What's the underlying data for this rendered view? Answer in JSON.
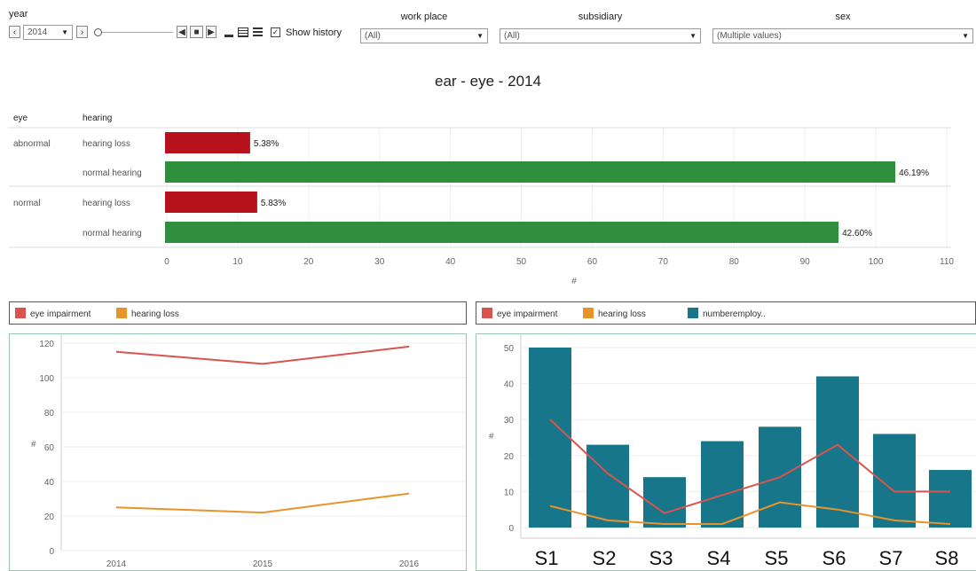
{
  "filters": {
    "year_label": "year",
    "year_value": "2014",
    "show_history_label": "Show history",
    "workplace_label": "work place",
    "workplace_value": "(All)",
    "subsidiary_label": "subsidiary",
    "subsidiary_value": "(All)",
    "sex_label": "sex",
    "sex_value": "(Multiple values)"
  },
  "icons": {
    "prev": "‹",
    "next": "›",
    "dropdown_arrow": "▼",
    "play_back": "◀",
    "stop": "■",
    "play": "▶",
    "check": "✓"
  },
  "colors": {
    "hearing_loss_bar": "#b5121b",
    "normal_hearing_bar": "#2f8f3c",
    "eye_impairment": "#d9544f",
    "hearing_loss_line": "#e8942a",
    "numberemployees": "#17768a"
  },
  "chart_data": [
    {
      "type": "bar",
      "orientation": "horizontal",
      "title": "ear - eye - 2014",
      "row_headers": [
        "eye",
        "hearing"
      ],
      "rows": [
        {
          "eye": "abnormal",
          "hearing": "hearing loss",
          "value": 12,
          "label": "5.38%"
        },
        {
          "eye": "",
          "hearing": "normal hearing",
          "value": 103,
          "label": "46.19%"
        },
        {
          "eye": "normal",
          "hearing": "hearing loss",
          "value": 13,
          "label": "5.83%"
        },
        {
          "eye": "",
          "hearing": "normal hearing",
          "value": 95,
          "label": "42.60%"
        }
      ],
      "xlim": [
        0,
        110
      ],
      "xticks": [
        0,
        10,
        20,
        30,
        40,
        50,
        60,
        70,
        80,
        90,
        100,
        110
      ],
      "xlabel": "#"
    },
    {
      "type": "line",
      "legend": [
        "eye impairment",
        "hearing loss"
      ],
      "x": [
        "2014",
        "2015",
        "2016"
      ],
      "series": [
        {
          "name": "eye impairment",
          "values": [
            115,
            108,
            118
          ]
        },
        {
          "name": "hearing loss",
          "values": [
            25,
            22,
            33
          ]
        }
      ],
      "ylim": [
        0,
        120
      ],
      "yticks": [
        0,
        20,
        40,
        60,
        80,
        100,
        120
      ],
      "ylabel": "#"
    },
    {
      "type": "bar",
      "legend": [
        "eye impairment",
        "hearing loss",
        "numberemploy.."
      ],
      "categories": [
        "S1",
        "S2",
        "S3",
        "S4",
        "S5",
        "S6",
        "S7",
        "S8"
      ],
      "series": [
        {
          "name": "numberemploy..",
          "kind": "bar",
          "values": [
            50,
            23,
            14,
            24,
            28,
            42,
            26,
            16
          ]
        },
        {
          "name": "eye impairment",
          "kind": "line",
          "values": [
            30,
            15,
            4,
            9,
            14,
            23,
            10,
            10
          ]
        },
        {
          "name": "hearing loss",
          "kind": "line",
          "values": [
            6,
            2,
            1,
            1,
            7,
            5,
            2,
            1
          ]
        }
      ],
      "ylim": [
        0,
        50
      ],
      "yticks": [
        0,
        10,
        20,
        30,
        40,
        50
      ],
      "ylabel": "#"
    }
  ]
}
